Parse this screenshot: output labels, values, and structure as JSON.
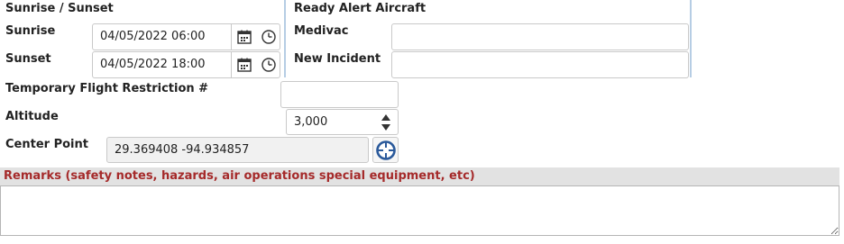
{
  "sunrise_sunset": {
    "title": "Sunrise / Sunset",
    "sunrise_label": "Sunrise",
    "sunrise_value": "04/05/2022 06:00",
    "sunset_label": "Sunset",
    "sunset_value": "04/05/2022 18:00"
  },
  "ready_alert": {
    "title": "Ready Alert Aircraft",
    "medivac_label": "Medivac",
    "medivac_value": "",
    "new_incident_label": "New Incident",
    "new_incident_value": ""
  },
  "tfr": {
    "label": "Temporary Flight Restriction #",
    "value": ""
  },
  "altitude": {
    "label": "Altitude",
    "value": "3,000"
  },
  "center_point": {
    "label": "Center Point",
    "value": "29.369408 -94.934857"
  },
  "remarks": {
    "label": "Remarks (safety notes, hazards, air operations special equipment, etc)",
    "value": ""
  },
  "colors": {
    "accent_line": "#b6cde4",
    "remarks_label": "#a52a2a",
    "remarks_bar": "#e2e2e2",
    "locate_icon": "#2b5a9b"
  },
  "icons": [
    "calendar-icon",
    "clock-icon",
    "spinner-up-icon",
    "spinner-down-icon",
    "crosshair-locate-icon"
  ]
}
